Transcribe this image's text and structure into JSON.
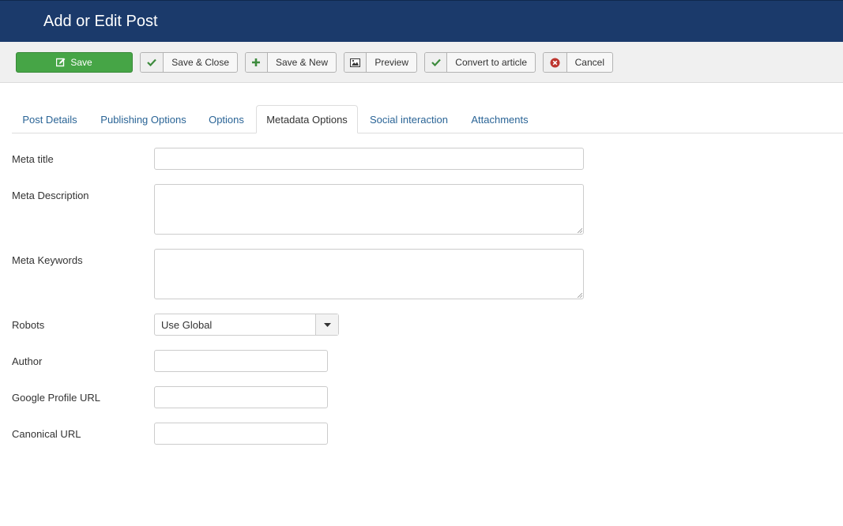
{
  "header": {
    "title": "Add or Edit Post"
  },
  "toolbar": {
    "save": {
      "label": "Save",
      "icon": "pencil-icon"
    },
    "save_close": {
      "label": "Save & Close",
      "icon": "check-icon"
    },
    "save_new": {
      "label": "Save & New",
      "icon": "plus-icon"
    },
    "preview": {
      "label": "Preview",
      "icon": "image-icon"
    },
    "convert": {
      "label": "Convert to article",
      "icon": "check-icon"
    },
    "cancel": {
      "label": "Cancel",
      "icon": "cancel-circle-icon"
    }
  },
  "tabs": [
    {
      "label": "Post Details",
      "active": false
    },
    {
      "label": "Publishing Options",
      "active": false
    },
    {
      "label": "Options",
      "active": false
    },
    {
      "label": "Metadata Options",
      "active": true
    },
    {
      "label": "Social interaction",
      "active": false
    },
    {
      "label": "Attachments",
      "active": false
    }
  ],
  "form": {
    "meta_title": {
      "label": "Meta title",
      "value": ""
    },
    "meta_description": {
      "label": "Meta Description",
      "value": ""
    },
    "meta_keywords": {
      "label": "Meta Keywords",
      "value": ""
    },
    "robots": {
      "label": "Robots",
      "value": "Use Global"
    },
    "author": {
      "label": "Author",
      "value": ""
    },
    "google_profile_url": {
      "label": "Google Profile URL",
      "value": ""
    },
    "canonical_url": {
      "label": "Canonical URL",
      "value": ""
    }
  },
  "colors": {
    "header_bg": "#1b3a6b",
    "save_green": "#46a546",
    "link_blue": "#2a6496",
    "cancel_red": "#bd362f"
  }
}
